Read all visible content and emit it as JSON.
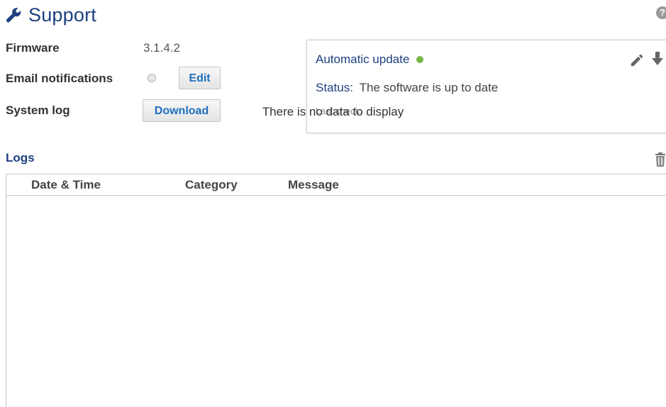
{
  "header": {
    "title": "Support",
    "help_icon": "?"
  },
  "settings": {
    "firmware_label": "Firmware",
    "firmware_value": "3.1.4.2",
    "email_label": "Email notifications",
    "edit_label": "Edit",
    "syslog_label": "System log",
    "download_label": "Download"
  },
  "update": {
    "title": "Automatic update",
    "status_label": "Status:",
    "status_value": "The software is up to date",
    "last_check_label": "Last check:",
    "status_color": "#7ab648"
  },
  "logs": {
    "title": "Logs",
    "columns": [
      "Date & Time",
      "Category",
      "Message"
    ],
    "empty_message": "There is no data to display"
  },
  "colors": {
    "accent": "#1f3f7f",
    "link": "#1f6fbf"
  }
}
